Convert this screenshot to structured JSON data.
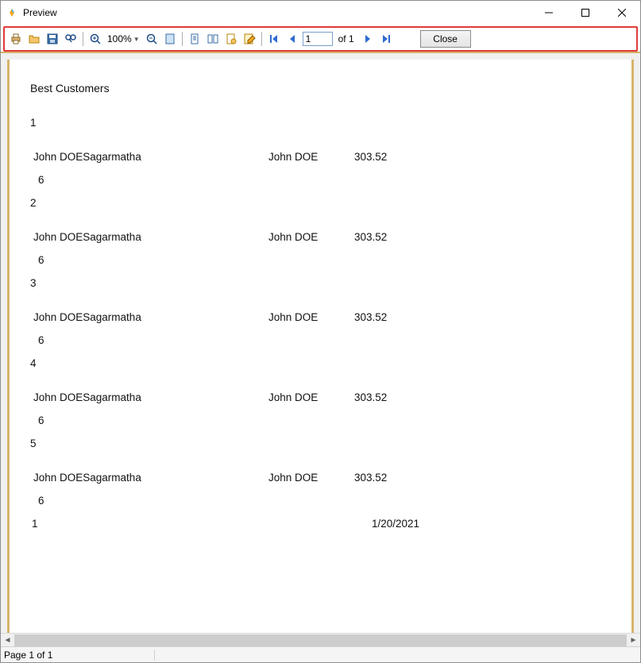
{
  "window": {
    "title": "Preview"
  },
  "toolbar": {
    "zoom_label": "100%",
    "page_current": "1",
    "page_of": "of 1",
    "close_label": "Close"
  },
  "report": {
    "title": "Best Customers",
    "groups": [
      {
        "index": "1",
        "col1": "John DOESagarmatha",
        "col2": "John DOE",
        "col3": "303.52",
        "sub": "6"
      },
      {
        "index": "2",
        "col1": "John DOESagarmatha",
        "col2": "John DOE",
        "col3": "303.52",
        "sub": "6"
      },
      {
        "index": "3",
        "col1": "John DOESagarmatha",
        "col2": "John DOE",
        "col3": "303.52",
        "sub": "6"
      },
      {
        "index": "4",
        "col1": "John DOESagarmatha",
        "col2": "John DOE",
        "col3": "303.52",
        "sub": "6"
      },
      {
        "index": "5",
        "col1": "John DOESagarmatha",
        "col2": "John DOE",
        "col3": "303.52",
        "sub": "6"
      }
    ],
    "footer_pageno": "1",
    "footer_date": "1/20/2021"
  },
  "status": {
    "page": "Page 1 of 1"
  }
}
